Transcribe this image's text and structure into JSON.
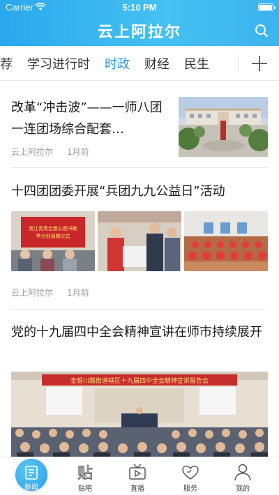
{
  "status_bar": {
    "carrier": "Carrier",
    "time": "5:10 PM"
  },
  "header": {
    "title": "云上阿拉尔",
    "search_icon": "search-icon"
  },
  "tabs": [
    {
      "label": "推荐",
      "active": false
    },
    {
      "label": "学习进行时",
      "active": false
    },
    {
      "label": "时政",
      "active": true
    },
    {
      "label": "财经",
      "active": false
    },
    {
      "label": "民生",
      "active": false
    }
  ],
  "tab_add_icon": "plus-icon",
  "articles": [
    {
      "title": "改革“冲击波”——一师八团一连团场综合配套…",
      "source": "云上阿拉尔",
      "time": "1月前",
      "layout": "right-thumbnail"
    },
    {
      "title": "十四团团委开展“兵团九九公益日”活动",
      "source": "云上阿拉尔",
      "time": "1月前",
      "layout": "three-images",
      "image_caption": "浙江青英会爱心图书助学计划捐赠仪式"
    },
    {
      "title": "党的十九届四中全会精神宣讲在师市持续展开",
      "layout": "large-image",
      "image_caption": "金银川路街道辖区十九届四中全会精神宣讲报告会"
    }
  ],
  "bottom_nav": [
    {
      "label": "新闻",
      "icon": "news-icon",
      "active": true
    },
    {
      "label": "贴吧",
      "icon": "post-bar-icon",
      "active": false
    },
    {
      "label": "直播",
      "icon": "live-tv-icon",
      "active": false
    },
    {
      "label": "服务",
      "icon": "service-heart-icon",
      "active": false
    },
    {
      "label": "我的",
      "icon": "profile-icon",
      "active": false
    }
  ],
  "colors": {
    "brand": "#2b9be6",
    "header_gradient_start": "#2aa8ec",
    "header_gradient_end": "#45c1f2"
  }
}
